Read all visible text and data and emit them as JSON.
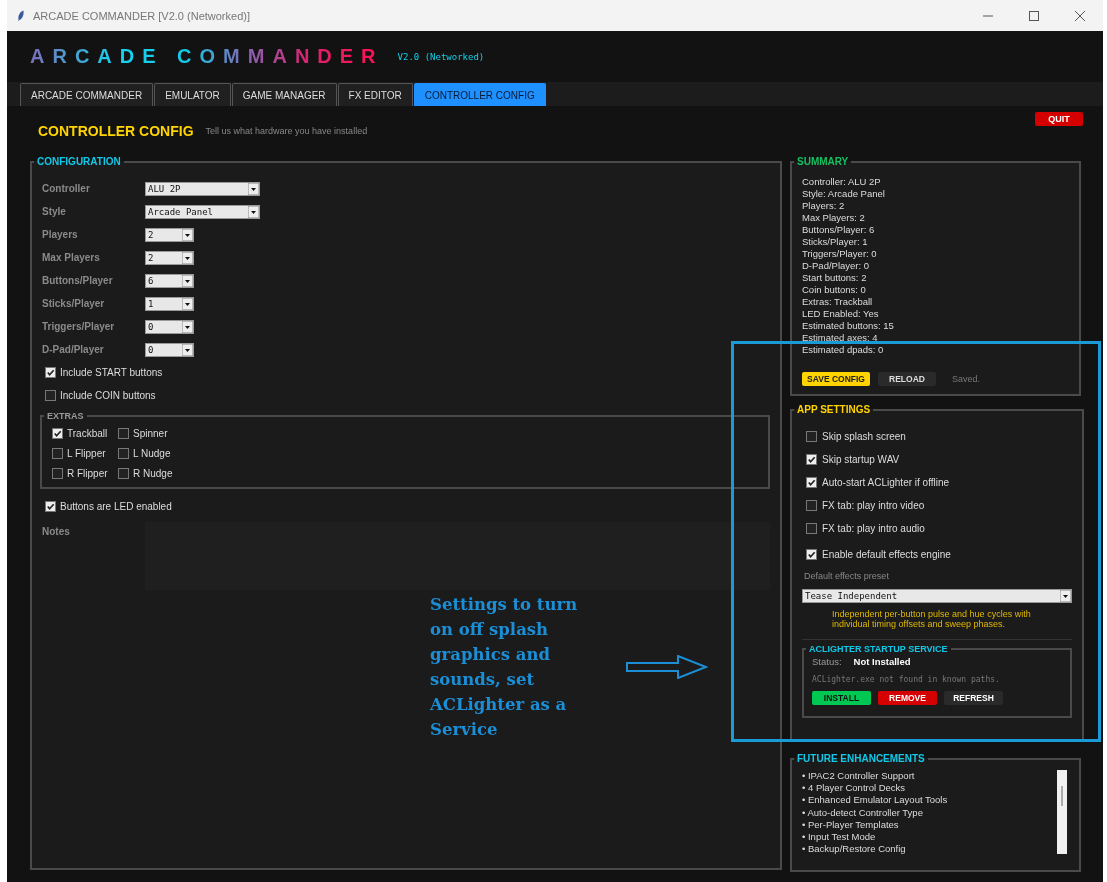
{
  "window": {
    "title": "ARCADE COMMANDER [V2.0 (Networked)]"
  },
  "header": {
    "logo": "ARCADE COMMANDER",
    "version": "V2.0 (Networked)"
  },
  "tabs": [
    {
      "label": "ARCADE COMMANDER",
      "selected": false
    },
    {
      "label": "EMULATOR",
      "selected": false
    },
    {
      "label": "GAME MANAGER",
      "selected": false
    },
    {
      "label": "FX EDITOR",
      "selected": false
    },
    {
      "label": "CONTROLLER CONFIG",
      "selected": true
    }
  ],
  "page": {
    "title": "CONTROLLER CONFIG",
    "subtitle": "Tell us what hardware you have installed",
    "quit": "QUIT"
  },
  "configuration": {
    "title": "CONFIGURATION",
    "fields": [
      {
        "label": "Controller",
        "value": "ALU 2P"
      },
      {
        "label": "Style",
        "value": "Arcade Panel"
      },
      {
        "label": "Players",
        "value": "2"
      },
      {
        "label": "Max Players",
        "value": "2"
      },
      {
        "label": "Buttons/Player",
        "value": "6"
      },
      {
        "label": "Sticks/Player",
        "value": "1"
      },
      {
        "label": "Triggers/Player",
        "value": "0"
      },
      {
        "label": "D-Pad/Player",
        "value": "0"
      }
    ],
    "options": [
      {
        "label": "Include START buttons",
        "checked": true
      },
      {
        "label": "Include COIN buttons",
        "checked": false
      }
    ],
    "extras": {
      "title": "EXTRAS",
      "items": [
        {
          "label": "Trackball",
          "checked": true
        },
        {
          "label": "Spinner",
          "checked": false
        },
        {
          "label": "L Flipper",
          "checked": false
        },
        {
          "label": "L Nudge",
          "checked": false
        },
        {
          "label": "R Flipper",
          "checked": false
        },
        {
          "label": "R Nudge",
          "checked": false
        }
      ]
    },
    "led": {
      "label": "Buttons are LED enabled",
      "checked": true
    },
    "notes": {
      "label": "Notes"
    }
  },
  "summary": {
    "title": "SUMMARY",
    "lines": [
      "Controller: ALU 2P",
      "Style: Arcade Panel",
      "Players: 2",
      "Max Players: 2",
      "Buttons/Player: 6",
      "Sticks/Player: 1",
      "Triggers/Player: 0",
      "D-Pad/Player: 0",
      "Start buttons: 2",
      "Coin buttons: 0",
      "Extras: Trackball",
      "LED Enabled: Yes",
      "Estimated buttons: 15",
      "Estimated axes: 4",
      "Estimated dpads: 0"
    ],
    "save": "SAVE CONFIG",
    "reload": "RELOAD",
    "status": "Saved."
  },
  "app_settings": {
    "title": "APP SETTINGS",
    "options": [
      {
        "label": "Skip splash screen",
        "checked": false
      },
      {
        "label": "Skip startup WAV",
        "checked": true
      },
      {
        "label": "Auto-start ACLighter if offline",
        "checked": true
      },
      {
        "label": "FX tab: play intro video",
        "checked": false
      },
      {
        "label": "FX tab: play intro audio",
        "checked": false
      },
      {
        "label": "Enable default effects engine",
        "checked": true
      }
    ],
    "preset_label": "Default effects preset",
    "preset": "Tease Independent",
    "description": "Independent per-button pulse and hue cycles with individual timing offsets and sweep phases.",
    "service": {
      "title": "ACLIGHTER STARTUP SERVICE",
      "status_label": "Status:",
      "status": "Not Installed",
      "message": "ACLighter.exe not found in known paths.",
      "buttons": [
        {
          "label": "INSTALL",
          "color": "#00c853"
        },
        {
          "label": "REMOVE",
          "color": "#d50000"
        },
        {
          "label": "REFRESH",
          "color": "#2a2a2a"
        }
      ]
    }
  },
  "future": {
    "title": "FUTURE ENHANCEMENTS",
    "items": [
      "• IPAC2 Controller Support",
      "• 4 Player Control Decks",
      "• Enhanced Emulator Layout Tools",
      "• Auto-detect Controller Type",
      "• Per-Player Templates",
      "• Input Test Mode",
      "• Backup/Restore Config"
    ]
  },
  "annotation": {
    "lines": [
      "Settings to turn",
      "on off splash",
      "graphics and",
      "sounds, set",
      "ACLighter as a",
      "Service"
    ]
  }
}
